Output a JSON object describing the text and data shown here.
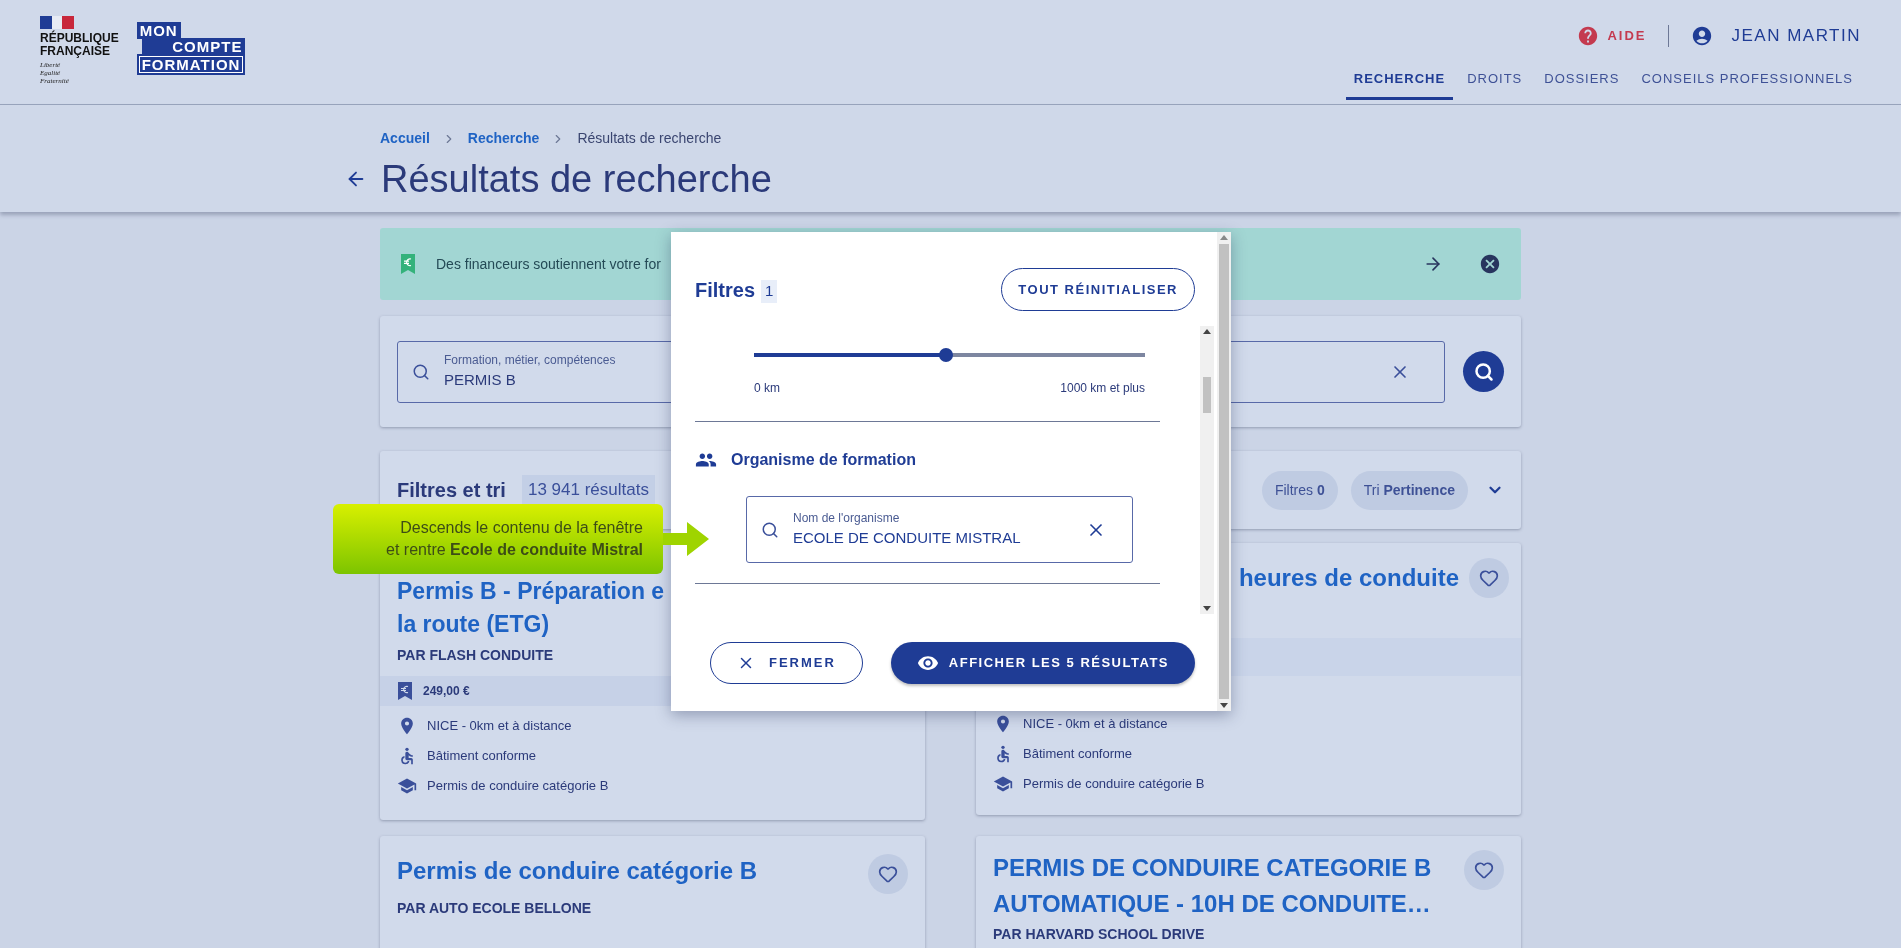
{
  "header": {
    "republic": "RÉPUBLIQUE\nFRANÇAISE",
    "motto": "Liberté\nEgalité\nFraternité",
    "brand": [
      "MON",
      "COMPTE",
      "FORMATION"
    ],
    "help": "AIDE",
    "user": "JEAN MARTIN",
    "nav": [
      {
        "label": "RECHERCHE",
        "selected": true
      },
      {
        "label": "DROITS",
        "selected": false
      },
      {
        "label": "DOSSIERS",
        "selected": false
      },
      {
        "label": "CONSEILS PROFESSIONNELS",
        "selected": false
      }
    ]
  },
  "breadcrumb": [
    {
      "label": "Accueil",
      "link": true
    },
    {
      "label": "Recherche",
      "link": true
    },
    {
      "label": "Résultats de recherche",
      "link": false
    }
  ],
  "page_title": "Résultats de recherche",
  "banner": {
    "text": "Des financeurs soutiennent votre for"
  },
  "search": {
    "label": "Formation, métier, compétences",
    "value": "PERMIS B"
  },
  "filters_bar": {
    "title": "Filtres et tri",
    "count": "13 941",
    "count_label": "résultats",
    "filters_button": "Filtres **0**",
    "sort_button": "Tri **Pertinence**"
  },
  "results": [
    {
      "title_lines": [
        "Permis B - Préparation e",
        "la route (ETG)"
      ],
      "provider": "PAR FLASH CONDUITE",
      "price": "249,00 €",
      "details": [
        {
          "kind": "location",
          "text": "NICE - 0km et à distance"
        },
        {
          "kind": "accessibility",
          "text": "Bâtiment conforme"
        },
        {
          "kind": "diploma",
          "text": "Permis de conduire catégorie B"
        }
      ]
    },
    {
      "title_lines": [
        "heures de conduite"
      ],
      "details": [
        {
          "kind": "location",
          "text": "NICE - 0km et à distance"
        },
        {
          "kind": "accessibility",
          "text": "Bâtiment conforme"
        },
        {
          "kind": "diploma",
          "text": "Permis de conduire catégorie B"
        }
      ]
    },
    {
      "title_lines": [
        "Permis de conduire catégorie B"
      ],
      "provider": "PAR AUTO ECOLE BELLONE"
    },
    {
      "title_lines": [
        "PERMIS DE CONDUIRE CATEGORIE B",
        "AUTOMATIQUE - 10H DE CONDUITE…"
      ],
      "provider": "PAR HARVARD SCHOOL DRIVE"
    }
  ],
  "modal": {
    "title": "Filtres",
    "count": "1",
    "reset": "TOUT RÉINITIALISER",
    "distance": {
      "level": 0.49,
      "min_label": "0 km",
      "max_label": "1000 km et plus"
    },
    "organisme": {
      "heading": "Organisme de formation",
      "label": "Nom de l'organisme",
      "value": "ECOLE DE CONDUITE MISTRAL"
    },
    "close": "FERMER",
    "apply": "AFFICHER LES 5 RÉSULTATS"
  },
  "callout": {
    "text": "Descends le contenu de la fenêtre\net rentre **Ecole de conduite Mistral**"
  }
}
